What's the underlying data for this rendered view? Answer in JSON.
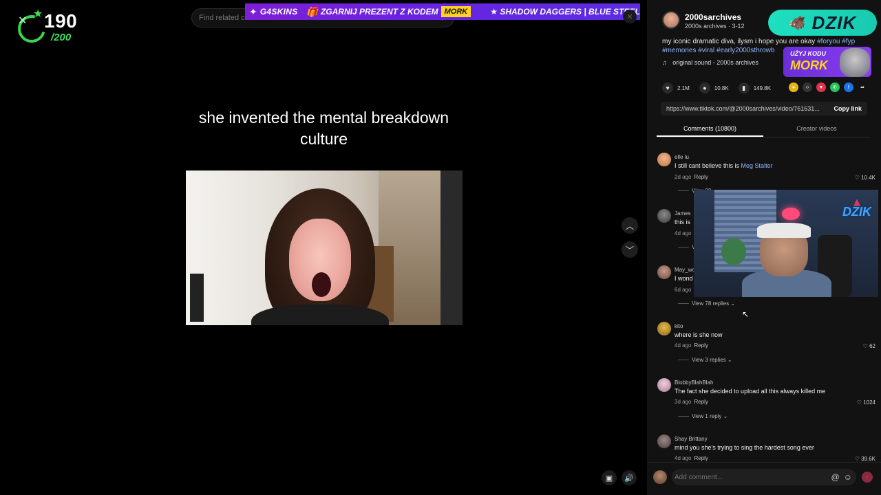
{
  "overlay": {
    "counter_value": "190",
    "counter_total": "/200",
    "banner": {
      "logo": "G4SKINS",
      "promo": "ZGARNIJ PREZENT Z KODEM",
      "code": "MORK",
      "items": "★ SHADOW DAGGERS | BLUE STEEL"
    },
    "dzik_logo": "DZIK",
    "code_badge_line1": "UŻYJ KODU",
    "code_badge_line2": "MORK",
    "webcam_brand": "DZIK"
  },
  "search": {
    "placeholder": "Find related content"
  },
  "video": {
    "caption": "she invented the mental breakdown culture"
  },
  "author": {
    "name": "2000sarchives",
    "subtitle": "2000s archives · 3-12"
  },
  "description": {
    "text": "my iconic dramatic diva, ilysm i hope you are okay",
    "tags": [
      "#foryou",
      "#fyp",
      "#memories",
      "#viral",
      "#early2000sthrowb"
    ]
  },
  "sound": {
    "label": "original sound - 2000s archives"
  },
  "stats": {
    "likes": "2.1M",
    "comments": "10.8K",
    "saves": "149.8K"
  },
  "link": {
    "url": "https://www.tiktok.com/@2000sarchives/video/761631...",
    "copy_label": "Copy link"
  },
  "tabs": [
    {
      "label": "Comments (10800)"
    },
    {
      "label": "Creator videos"
    }
  ],
  "comments": [
    {
      "user": "elle lu",
      "text": "I still cant believe this is ",
      "mention": "Meg Stalter",
      "time": "2d ago",
      "reply": "Reply",
      "likes": "10.4K",
      "replies": "View 20"
    },
    {
      "user": "James",
      "text": "this is",
      "time": "4d ago",
      "reply": "Reply",
      "likes": "",
      "replies": "V"
    },
    {
      "user": "May_wo",
      "text": "I wond",
      "time": "6d ago",
      "reply": "Reply",
      "likes": "",
      "replies": "View 78 replies"
    },
    {
      "user": "kito",
      "text": "where is she now",
      "time": "4d ago",
      "reply": "Reply",
      "likes": "62",
      "replies": "View 3 replies"
    },
    {
      "user": "BlobbyBlahBlah",
      "text": "The fact she decided to upload all this always killed me",
      "time": "3d ago",
      "reply": "Reply",
      "likes": "1024",
      "replies": "View 1 reply"
    },
    {
      "user": "Shay Brittany",
      "text": "mind you she's trying to sing the hardest song ever",
      "time": "4d ago",
      "reply": "Reply",
      "likes": "39.6K",
      "replies": ""
    }
  ],
  "comment_box": {
    "placeholder": "Add comment..."
  },
  "icons": {
    "heart": "heart-icon",
    "comment": "comment-icon",
    "bookmark": "bookmark-icon",
    "up": "chevron-up-icon",
    "down": "chevron-down-icon"
  }
}
